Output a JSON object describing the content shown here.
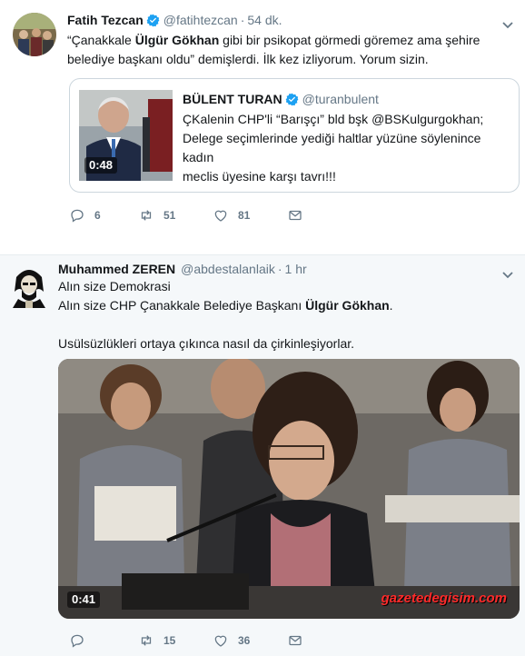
{
  "tweet1": {
    "author_name": "Fatih Tezcan",
    "handle": "@fatihtezcan",
    "separator": "·",
    "time": "54 dk.",
    "text_line1_prefix": "“Çanakkale ",
    "text_line1_bold": "Ülgür Gökhan",
    "text_line1_suffix": " gibi bir psikopat görmedi göremez ama şehire",
    "text_line2": "belediye başkanı oldu” demişlerdi. İlk kez izliyorum. Yorum sizin.",
    "quote": {
      "author_name": "BÜLENT TURAN",
      "handle": "@turanbulent",
      "text_line1": "ÇKalenin CHP'li “Barışçı” bld bşk @BSKulgurgokhan;",
      "text_line2": "Delege seçimlerinde yediği haltlar yüzüne söylenince kadın",
      "text_line3": "meclis üyesine karşı tavrı!!!",
      "video_duration": "0:48"
    },
    "actions": {
      "replies": "6",
      "retweets": "51",
      "likes": "81"
    }
  },
  "tweet2": {
    "author_name": "Muhammed ZEREN",
    "handle": "@abdestalanlaik",
    "separator": "·",
    "time": "1 hr",
    "text_line1": "Alın size Demokrasi",
    "text_line2_prefix": "Alın size CHP Çanakkale Belediye Başkanı ",
    "text_line2_bold": "Ülgür Gökhan",
    "text_line2_suffix": ".",
    "text_line3": "Usülsüzlükleri ortaya çıkınca nasıl da çirkinleşiyorlar.",
    "video_duration": "0:41",
    "watermark": "gazetedegisim.com",
    "actions": {
      "replies": "",
      "retweets": "15",
      "likes": "36"
    }
  },
  "colors": {
    "verified": "#1da1f2",
    "secondary_text": "#657786",
    "divider": "#e6ecf0",
    "watermark": "#ff2a2a"
  },
  "icons": [
    "verified-icon",
    "chevron-down-icon",
    "reply-icon",
    "retweet-icon",
    "like-icon",
    "direct-message-icon"
  ]
}
